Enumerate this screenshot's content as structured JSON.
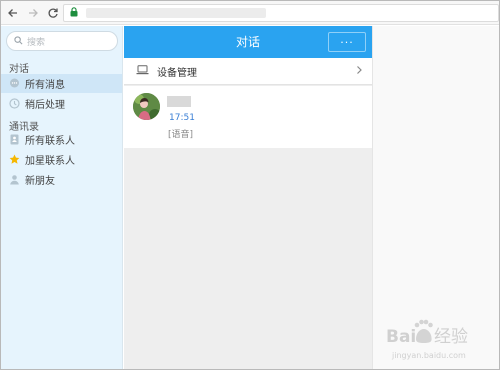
{
  "browser": {
    "back_icon": "arrow-left-icon",
    "forward_icon": "arrow-right-icon",
    "reload_icon": "reload-icon",
    "lock_icon": "lock-icon"
  },
  "sidebar": {
    "search_placeholder": "搜索",
    "sections": [
      {
        "title": "对话",
        "items": [
          {
            "label": "所有消息",
            "icon": "chat-bubble-icon",
            "active": true
          },
          {
            "label": "稍后处理",
            "icon": "clock-icon",
            "active": false
          }
        ]
      },
      {
        "title": "通讯录",
        "items": [
          {
            "label": "所有联系人",
            "icon": "contacts-book-icon",
            "active": false
          },
          {
            "label": "加星联系人",
            "icon": "star-icon",
            "active": false
          },
          {
            "label": "新朋友",
            "icon": "person-icon",
            "active": false
          }
        ]
      }
    ]
  },
  "conversation": {
    "title": "对话",
    "more_label": "···",
    "device_row": {
      "label": "设备管理",
      "icon": "laptop-icon"
    },
    "messages": [
      {
        "time": "17:51",
        "preview": "[语音]"
      }
    ]
  },
  "colors": {
    "header_blue": "#2aa3f0",
    "sidebar_bg": "#e6f4fd",
    "time_blue": "#3a7fd5"
  }
}
